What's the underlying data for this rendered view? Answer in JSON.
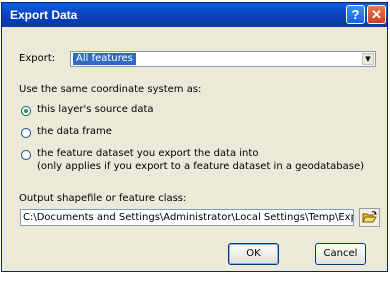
{
  "window": {
    "title": "Export Data",
    "help_label": "?",
    "close_label": "✕"
  },
  "export": {
    "label": "Export:",
    "selected": "All features",
    "dropdown_glyph": "▼"
  },
  "coord": {
    "heading": "Use the same coordinate system as:",
    "options": [
      {
        "label": "this layer's source data",
        "selected": true
      },
      {
        "label": "the data frame",
        "selected": false
      },
      {
        "label": "the feature dataset you export the data into",
        "selected": false
      }
    ],
    "note": "(only applies if you export to a feature dataset in a geodatabase)"
  },
  "output": {
    "label": "Output shapefile or feature class:",
    "value": "C:\\Documents and Settings\\Administrator\\Local Settings\\Temp\\Exp"
  },
  "buttons": {
    "ok": "OK",
    "cancel": "Cancel"
  },
  "icons": {
    "browse": "open-folder-icon"
  },
  "colors": {
    "titlebar": "#0a4fd0",
    "selection": "#316ac5",
    "dialog_bg": "#ece9d8"
  }
}
